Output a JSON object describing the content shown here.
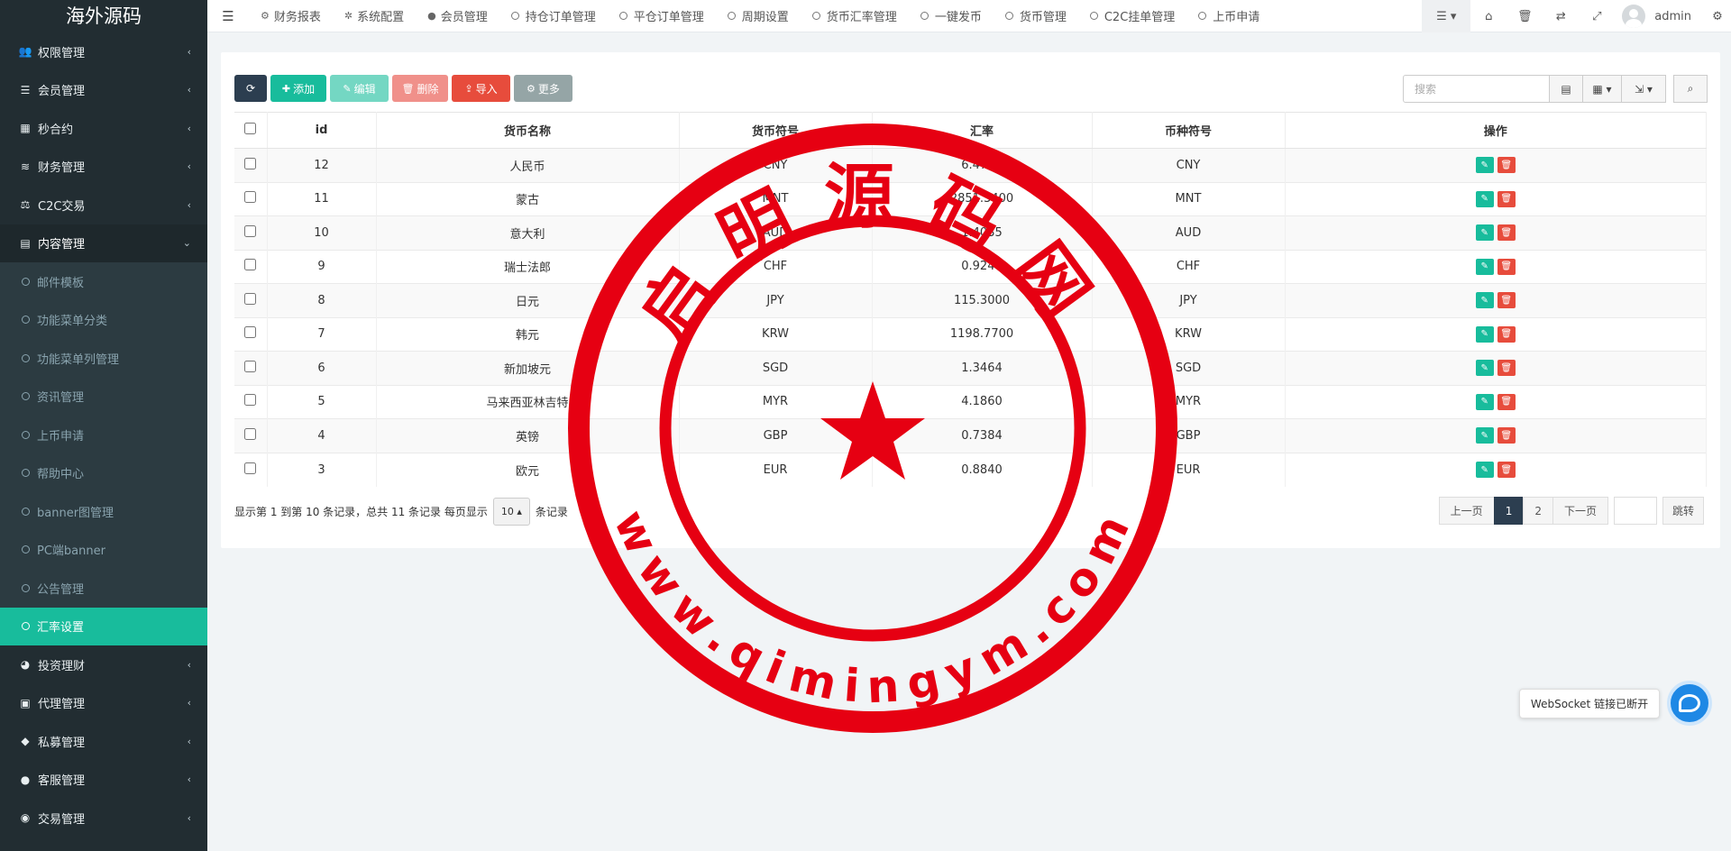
{
  "brand": "海外源码",
  "sidebar": {
    "items_before": [
      {
        "icon": "users-icon",
        "glyph": "👥",
        "label": "权限管理"
      },
      {
        "icon": "list-icon",
        "glyph": "☰",
        "label": "会员管理"
      },
      {
        "icon": "calendar-icon",
        "glyph": "▦",
        "label": "秒合约"
      },
      {
        "icon": "database-icon",
        "glyph": "≋",
        "label": "财务管理"
      },
      {
        "icon": "scale-icon",
        "glyph": "⚖",
        "label": "C2C交易"
      },
      {
        "icon": "content-icon",
        "glyph": "▤",
        "label": "内容管理"
      }
    ],
    "submenu": [
      "邮件模板",
      "功能菜单分类",
      "功能菜单列管理",
      "资讯管理",
      "上币申请",
      "帮助中心",
      "banner图管理",
      "PC端banner",
      "公告管理",
      "汇率设置"
    ],
    "active_sub": "汇率设置",
    "items_after": [
      {
        "icon": "compass-icon",
        "glyph": "◕",
        "label": "投资理财"
      },
      {
        "icon": "briefcase-icon",
        "glyph": "▣",
        "label": "代理管理"
      },
      {
        "icon": "diamond-icon",
        "glyph": "◆",
        "label": "私募管理"
      },
      {
        "icon": "comment-icon",
        "glyph": "●",
        "label": "客服管理"
      },
      {
        "icon": "eye-icon",
        "glyph": "◉",
        "label": "交易管理"
      }
    ]
  },
  "topbar": {
    "tabs": [
      {
        "label": "财务报表",
        "icon": "dashboard-icon",
        "glyph": "⚙"
      },
      {
        "label": "系统配置",
        "icon": "cog-icon",
        "glyph": "✲"
      },
      {
        "label": "会员管理",
        "icon": "user-icon",
        "glyph": "●"
      },
      {
        "label": "持仓订单管理",
        "icon": "circle-icon"
      },
      {
        "label": "平仓订单管理",
        "icon": "circle-icon"
      },
      {
        "label": "周期设置",
        "icon": "circle-icon"
      },
      {
        "label": "货币汇率管理",
        "icon": "circle-icon"
      },
      {
        "label": "一键发币",
        "icon": "circle-icon"
      },
      {
        "label": "货币管理",
        "icon": "circle-icon"
      },
      {
        "label": "C2C挂单管理",
        "icon": "circle-icon"
      },
      {
        "label": "上币申请",
        "icon": "circle-icon"
      }
    ],
    "user": "admin"
  },
  "toolbar": {
    "add": "添加",
    "edit": "编辑",
    "delete": "删除",
    "import": "导入",
    "more": "更多"
  },
  "search": {
    "placeholder": "搜索"
  },
  "table": {
    "columns": [
      "id",
      "货币名称",
      "货币符号",
      "汇率",
      "币种符号",
      "操作"
    ],
    "rows": [
      {
        "id": "12",
        "name": "人民币",
        "code": "CNY",
        "rate": "6.4713",
        "symbol": "CNY"
      },
      {
        "id": "11",
        "name": "蒙古",
        "code": "MNT",
        "rate": "2851.3400",
        "symbol": "MNT"
      },
      {
        "id": "10",
        "name": "意大利",
        "code": "AUD",
        "rate": "1.4035",
        "symbol": "AUD"
      },
      {
        "id": "9",
        "name": "瑞士法郎",
        "code": "CHF",
        "rate": "0.9240",
        "symbol": "CHF"
      },
      {
        "id": "8",
        "name": "日元",
        "code": "JPY",
        "rate": "115.3000",
        "symbol": "JPY"
      },
      {
        "id": "7",
        "name": "韩元",
        "code": "KRW",
        "rate": "1198.7700",
        "symbol": "KRW"
      },
      {
        "id": "6",
        "name": "新加坡元",
        "code": "SGD",
        "rate": "1.3464",
        "symbol": "SGD"
      },
      {
        "id": "5",
        "name": "马来西亚林吉特",
        "code": "MYR",
        "rate": "4.1860",
        "symbol": "MYR"
      },
      {
        "id": "4",
        "name": "英镑",
        "code": "GBP",
        "rate": "0.7384",
        "symbol": "GBP"
      },
      {
        "id": "3",
        "name": "欧元",
        "code": "EUR",
        "rate": "0.8840",
        "symbol": "EUR"
      }
    ]
  },
  "pagination": {
    "info_prefix": "显示第 1 到第 10 条记录，总共 11 条记录 每页显示",
    "page_size": "10",
    "info_suffix": "条记录",
    "prev": "上一页",
    "pages": [
      "1",
      "2"
    ],
    "next": "下一页",
    "jump": "跳转"
  },
  "watermark": {
    "top_text": "启明源码网",
    "bottom_text": "www.qimingym.com",
    "color": "#e60012"
  },
  "websocket": {
    "status": "WebSocket 链接已断开"
  }
}
